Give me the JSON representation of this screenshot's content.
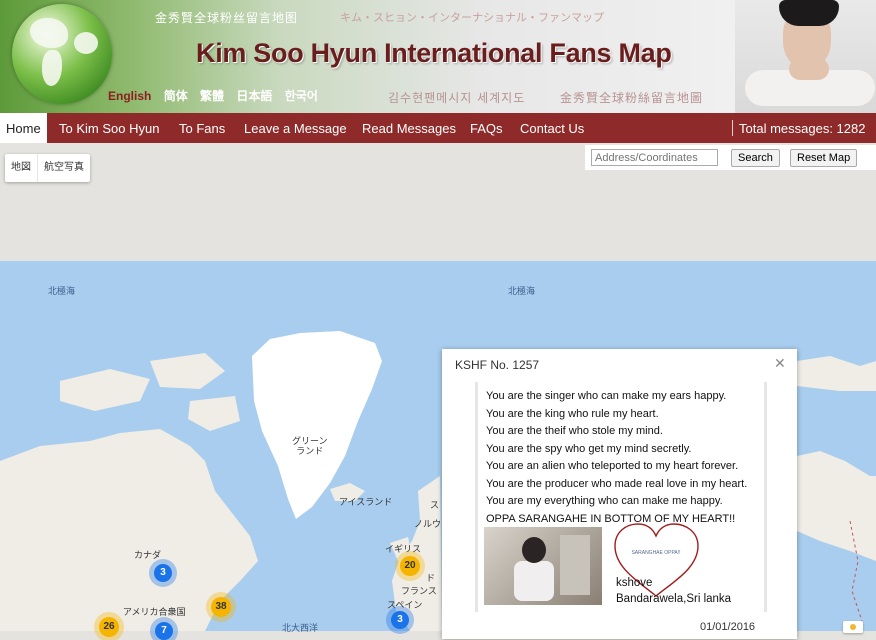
{
  "header": {
    "cjk_top_left": "金秀賢全球粉丝留言地图",
    "jp_top": "キム・スヒョン・インターナショナル・ファンマップ",
    "title": "Kim Soo Hyun International Fans Map",
    "languages": [
      "English",
      "简体",
      "繁體",
      "日本語",
      "한국어"
    ],
    "active_language": "English",
    "kr_bottom": "김수현팬메시지 세계지도",
    "tw_bottom": "金秀賢全球粉絲留言地圖",
    "colors": {
      "title": "#6a1d1d",
      "nav": "#8f2a2a",
      "active_language": "#8b1e1e"
    }
  },
  "nav": {
    "items": [
      "Home",
      "To Kim Soo Hyun",
      "To Fans",
      "Leave a Message",
      "Read Messages",
      "FAQs",
      "Contact Us"
    ],
    "active": "Home",
    "total": "Total messages: 1282"
  },
  "map": {
    "map_types": [
      "地図",
      "航空写真"
    ],
    "search_placeholder": "Address/Coordinates",
    "search_button": "Search",
    "reset_button": "Reset Map",
    "labels": {
      "arctic_left": "北極海",
      "arctic_right": "北極海",
      "greenland": "グリーン\nランド",
      "iceland": "アイスランド",
      "sweden_partial": "ス",
      "norway_partial": "ノルウェ",
      "canada": "カナダ",
      "usa": "アメリカ合衆国",
      "uk": "イギリス",
      "germany_partial": "ド",
      "france": "フランス",
      "spain": "スペイン",
      "atlantic": "北大西洋"
    },
    "clusters": [
      {
        "count": "3",
        "color": "blue"
      },
      {
        "count": "38",
        "color": "yellow"
      },
      {
        "count": "26",
        "color": "yellow"
      },
      {
        "count": "7",
        "color": "blue"
      },
      {
        "count": "20",
        "color": "yellow"
      },
      {
        "count": "3",
        "color": "blue"
      }
    ]
  },
  "popup": {
    "title": "KSHF No. 1257",
    "close_icon": "close-icon",
    "lines": [
      "You are the singer who can make my ears happy.",
      "You are the king who rule my heart.",
      "You are the theif who stole my mind.",
      "You are the spy who get my mind secretly.",
      "You are an alien who teleported to my heart forever.",
      "You are the producer who made real love in my heart.",
      "You are my everything who can make me happy.",
      "OPPA SARANGAHE IN BOTTOM OF MY HEART!!"
    ],
    "heart_text": "SARANGHAE OPPA!!",
    "sign_name": "kshove",
    "sign_place": "Bandarawela,Sri lanka",
    "date": "01/01/2016"
  }
}
